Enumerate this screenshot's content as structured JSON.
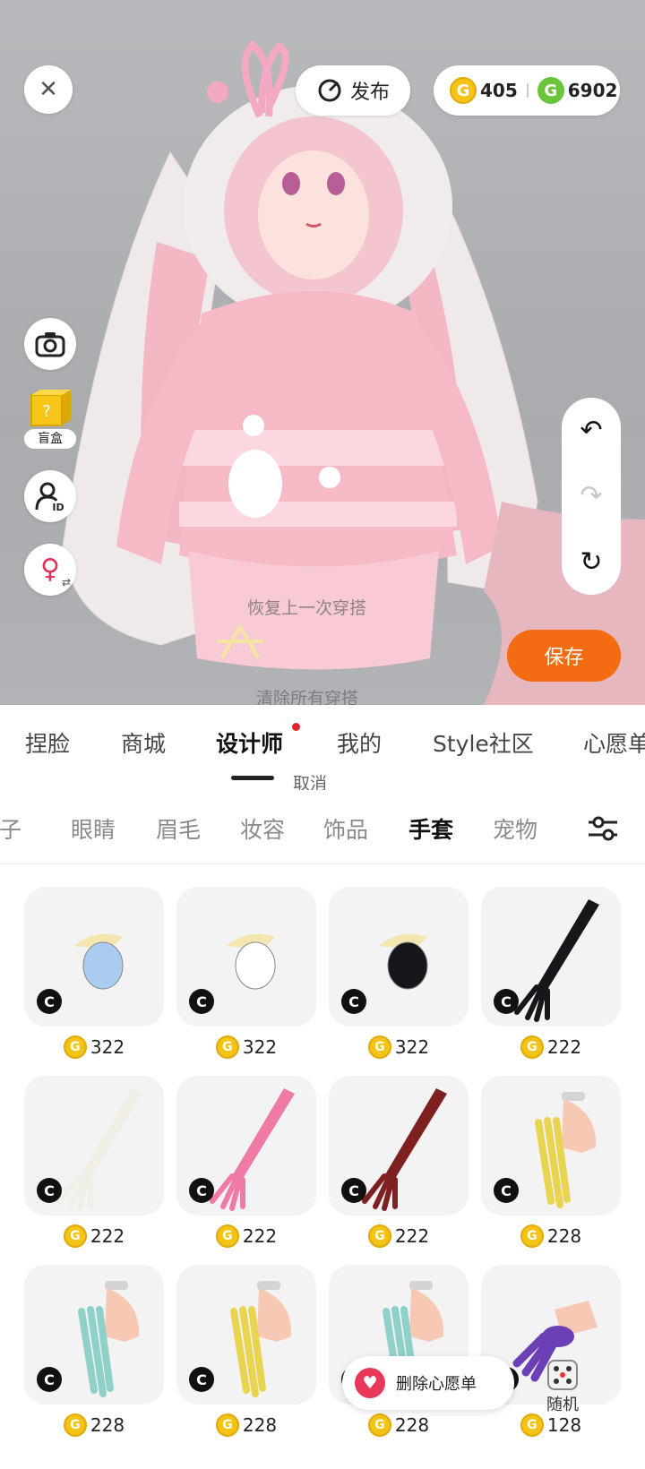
{
  "header": {
    "publish_label": "发布",
    "gold_balance": "405",
    "gem_balance": "6902",
    "gold_coin_glyph": "G",
    "gem_coin_glyph": "G"
  },
  "side_tools": {
    "blindbox_label": "盲盒"
  },
  "overlay": {
    "restore_label": "恢复上一次穿搭",
    "clear_label": "清除所有穿搭",
    "save_label": "保存"
  },
  "main_tabs": [
    {
      "label": "捏脸"
    },
    {
      "label": "商城"
    },
    {
      "label": "设计师"
    },
    {
      "label": "我的"
    },
    {
      "label": "Style社区"
    },
    {
      "label": "心愿单"
    }
  ],
  "cancel_label": "取消",
  "sub_tabs": [
    {
      "label": "鞋子"
    },
    {
      "label": "眼睛"
    },
    {
      "label": "眉毛"
    },
    {
      "label": "妆容"
    },
    {
      "label": "饰品"
    },
    {
      "label": "手套"
    },
    {
      "label": "宠物"
    }
  ],
  "items": [
    {
      "price": "322",
      "kind": "mitten",
      "color": "#a9ccf0"
    },
    {
      "price": "322",
      "kind": "mitten",
      "color": "#ffffff"
    },
    {
      "price": "322",
      "kind": "mitten",
      "color": "#15161b"
    },
    {
      "price": "222",
      "kind": "long-glove",
      "color": "#16171b"
    },
    {
      "price": "222",
      "kind": "long-glove",
      "color": "#f2efe6"
    },
    {
      "price": "222",
      "kind": "long-glove",
      "color": "#f07aa6"
    },
    {
      "price": "222",
      "kind": "long-glove",
      "color": "#7e2020"
    },
    {
      "price": "228",
      "kind": "nails",
      "color": "#e9d452"
    },
    {
      "price": "228",
      "kind": "nails",
      "color": "#8fd0c8"
    },
    {
      "price": "228",
      "kind": "nails",
      "color": "#e9d452"
    },
    {
      "price": "228",
      "kind": "nails",
      "color": "#8fd0c8"
    },
    {
      "price": "128",
      "kind": "claw",
      "color": "#6b3fb6"
    }
  ],
  "creator_badge": "C",
  "wishlist": {
    "label": "删除心愿单"
  },
  "random": {
    "label": "随机"
  },
  "colors": {
    "accent_orange": "#f36c11",
    "notification_dot": "#e5232c",
    "coin_gold": "#f3c316",
    "coin_green": "#6bc53a"
  }
}
